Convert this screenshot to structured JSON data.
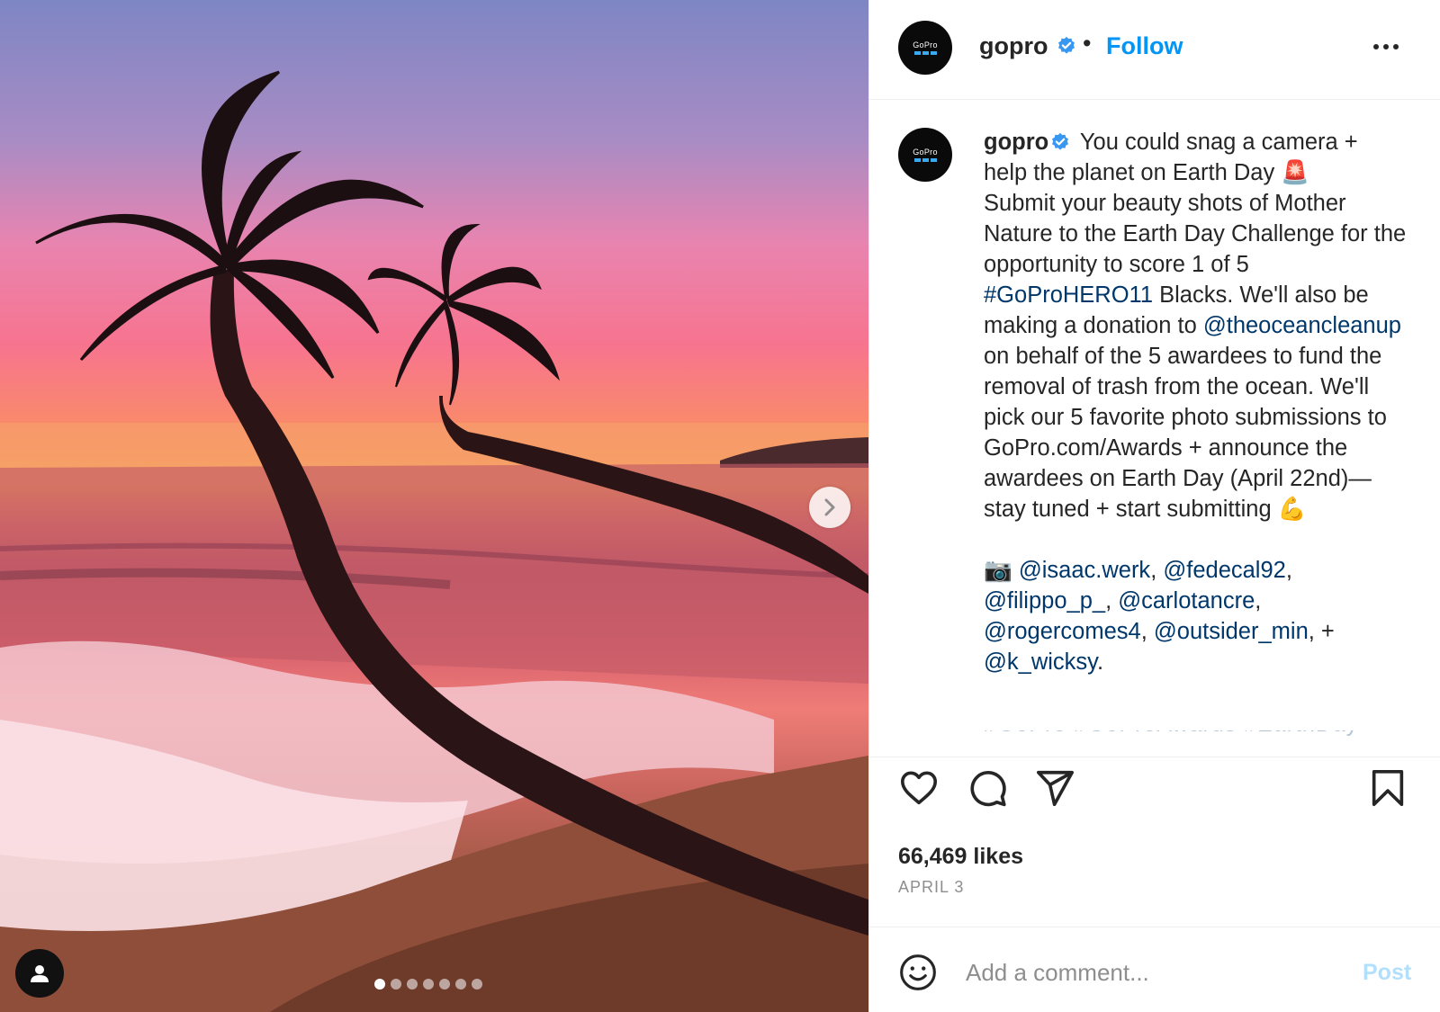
{
  "post": {
    "username": "gopro",
    "verified": true,
    "separator": "•",
    "follow_label": "Follow",
    "avatar_logo_text": "GoPro",
    "media": {
      "slide_count": 7,
      "active_slide": 1
    }
  },
  "caption": {
    "username": "gopro",
    "seg1": " You could snag a camera + help the planet on Earth Day 🚨\nSubmit your beauty shots of Mother Nature to the Earth Day Challenge for the opportunity to score 1 of 5 ",
    "hashtag1": "#GoProHERO11",
    "seg2": " Blacks. We'll also be making a donation to ",
    "mention_org": "@theoceancleanup",
    "seg3": " on behalf of the 5 awardees to fund the removal of trash from the ocean. We'll pick our 5 favorite photo submissions to GoPro.com/Awards + announce the awardees on Earth Day (April 22nd)—stay tuned + start submitting 💪\n\n📷 ",
    "m1": "@isaac.werk",
    "c1": ", ",
    "m2": "@fedecal92",
    "c2": ",\n",
    "m3": "@filippo_p_",
    "c3": ", ",
    "m4": "@carlotancre",
    "c4": ",\n",
    "m5": "@rogercomes4",
    "c5": ", ",
    "m6": "@outsider_min",
    "c6": ", +\n",
    "m7": "@k_wicksy",
    "c7": ".",
    "cut_hashtags": "#GoPro #GoProAwards #EarthDay"
  },
  "actions": {
    "like_icon": "heart-icon",
    "comment_icon": "comment-icon",
    "share_icon": "share-icon",
    "save_icon": "bookmark-icon",
    "likes": "66,469 likes",
    "date": "APRIL 3"
  },
  "comment": {
    "placeholder": "Add a comment...",
    "post_label": "Post"
  },
  "colors": {
    "link": "#00376b",
    "follow": "#0095f6",
    "post_disabled": "#b2dffc",
    "verified": "#3897f0"
  }
}
